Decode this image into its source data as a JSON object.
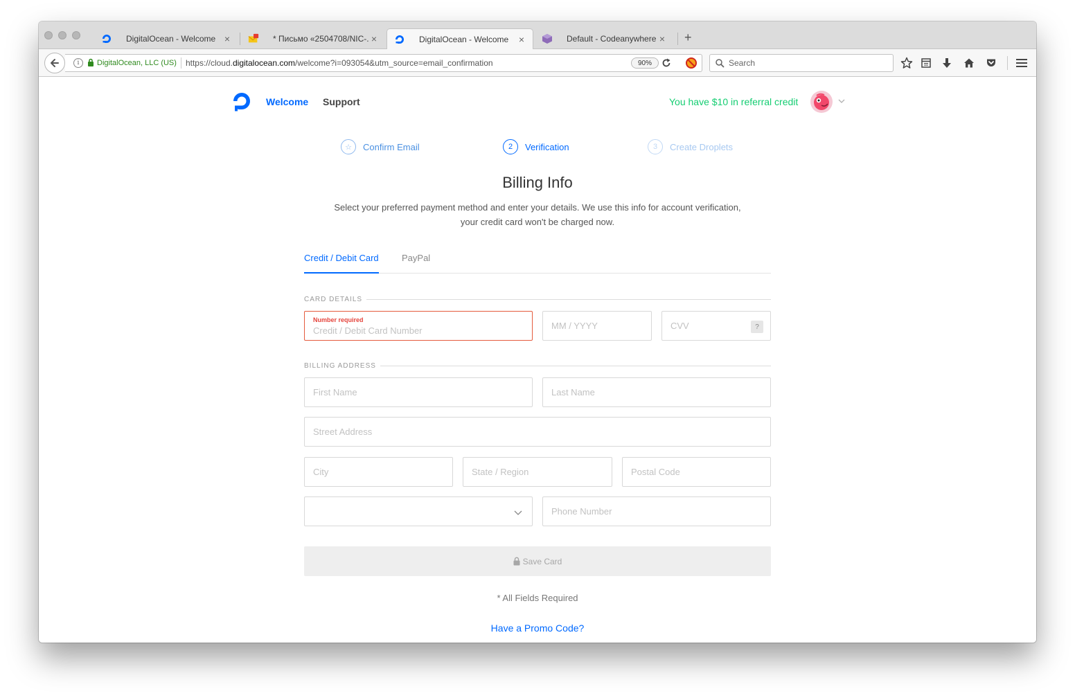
{
  "browser": {
    "tabs": [
      {
        "title": "DigitalOcean - Welcome",
        "icon": "digitalocean-icon",
        "active": false
      },
      {
        "title": "* Письмо «2504708/NIC-...",
        "icon": "mail-icon",
        "active": false
      },
      {
        "title": "DigitalOcean - Welcome",
        "icon": "digitalocean-icon",
        "active": true
      },
      {
        "title": "Default - Codeanywhere",
        "icon": "codeanywhere-icon",
        "active": false
      }
    ],
    "close_glyph": "×",
    "new_tab_glyph": "+",
    "identity_org": "DigitalOcean, LLC (US)",
    "url_prefix": "https://cloud.",
    "url_domain": "digitalocean.com",
    "url_rest": "/welcome?i=093054&utm_source=email_confirmation",
    "zoom": "90%",
    "search_placeholder": "Search",
    "mail_badge": "1"
  },
  "header": {
    "nav_welcome": "Welcome",
    "nav_support": "Support",
    "referral_text": "You have $10 in referral credit"
  },
  "steps": {
    "step1": {
      "label": "Confirm Email",
      "marker": "☆"
    },
    "step2": {
      "label": "Verification",
      "marker": "2"
    },
    "step3": {
      "label": "Create Droplets",
      "marker": "3"
    }
  },
  "billing": {
    "title": "Billing Info",
    "description_line1": "Select your preferred payment method and enter your details. We use this info for account verification,",
    "description_line2": "your credit card won't be charged now.",
    "tab_card": "Credit / Debit Card",
    "tab_paypal": "PayPal"
  },
  "card_details": {
    "section_label": "CARD DETAILS",
    "number_error": "Number required",
    "number_placeholder": "Credit / Debit Card Number",
    "expiry_placeholder": "MM / YYYY",
    "cvv_placeholder": "CVV",
    "cvv_help": "?"
  },
  "billing_address": {
    "section_label": "BILLING ADDRESS",
    "first_name_placeholder": "First Name",
    "last_name_placeholder": "Last Name",
    "street_placeholder": "Street Address",
    "city_placeholder": "City",
    "state_placeholder": "State / Region",
    "postal_placeholder": "Postal Code",
    "country_value": "",
    "phone_placeholder": "Phone Number"
  },
  "footer": {
    "save_button": "Save Card",
    "all_required": "* All Fields Required",
    "promo_link": "Have a Promo Code?"
  },
  "colors": {
    "brand_blue": "#0069ff",
    "referral_green": "#15cd72",
    "error_red": "#e5443c"
  }
}
